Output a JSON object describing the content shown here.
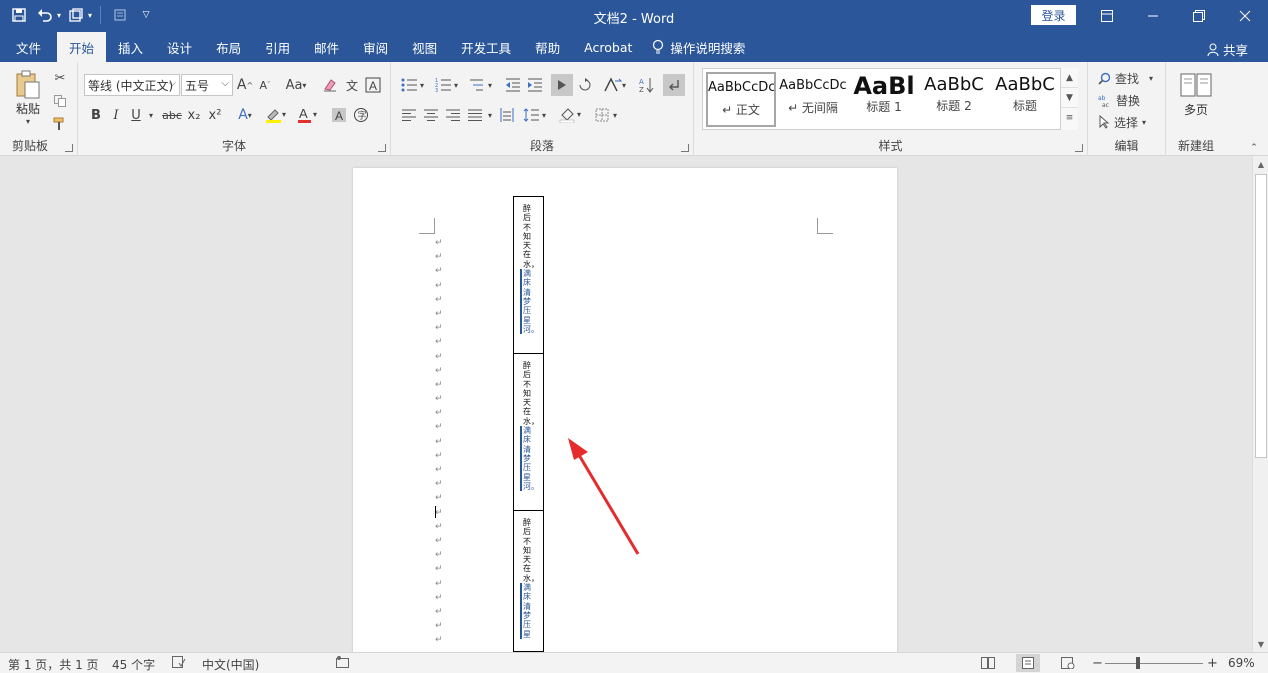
{
  "window": {
    "title": "文档2 - Word",
    "login": "登录",
    "share": "共享"
  },
  "qat": {
    "save_icon": "save-icon",
    "undo_icon": "undo-icon",
    "redo_icon": "redo-icon"
  },
  "tabs": [
    "文件",
    "开始",
    "插入",
    "设计",
    "布局",
    "引用",
    "邮件",
    "审阅",
    "视图",
    "开发工具",
    "帮助",
    "Acrobat"
  ],
  "active_tab": "开始",
  "tell_me": "操作说明搜索",
  "ribbon": {
    "clipboard": {
      "label": "剪贴板",
      "paste": "粘贴"
    },
    "font": {
      "label": "字体",
      "font_name": "等线 (中文正文)",
      "font_size": "五号",
      "grow": "A",
      "shrink": "A",
      "case": "Aa",
      "bold": "B",
      "italic": "I",
      "underline": "U",
      "strike": "abc",
      "sub": "x₂",
      "sup": "x²"
    },
    "paragraph": {
      "label": "段落"
    },
    "styles": {
      "label": "样式",
      "items": [
        {
          "sample": "AaBbCcDc",
          "name": "↵ 正文"
        },
        {
          "sample": "AaBbCcDc",
          "name": "↵ 无间隔"
        },
        {
          "sample": "AaBl",
          "name": "标题 1"
        },
        {
          "sample": "AaBbC",
          "name": "标题 2"
        },
        {
          "sample": "AaBbC",
          "name": "标题"
        }
      ]
    },
    "editing": {
      "label": "编辑",
      "find": "查找",
      "replace": "替换",
      "select": "选择"
    },
    "newgroup": {
      "label": "新建组",
      "multipage": "多页"
    }
  },
  "document": {
    "cell_text": "醉后不知天在水，",
    "cell_highlight": "满床清梦压星河。",
    "cell_highlight_short": "满床清梦压星"
  },
  "status": {
    "page": "第 1 页，共 1 页",
    "words": "45 个字",
    "language": "中文(中国)",
    "zoom": "69%"
  }
}
